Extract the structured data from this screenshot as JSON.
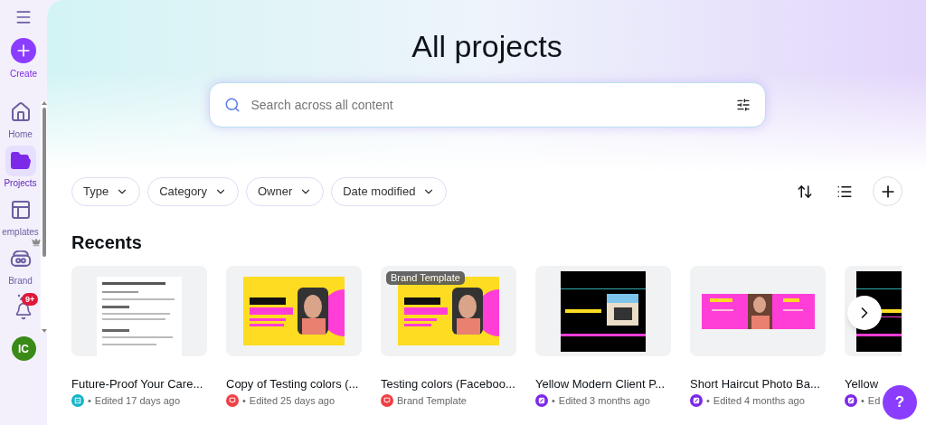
{
  "sidebar": {
    "create": {
      "label": "Create"
    },
    "items": [
      {
        "label": "Home",
        "kind": "home",
        "selected": false,
        "crown": false
      },
      {
        "label": "Projects",
        "kind": "folder",
        "selected": true,
        "crown": false
      },
      {
        "label": "emplates",
        "kind": "templates",
        "selected": false,
        "crown": false
      },
      {
        "label": "Brand",
        "kind": "brand",
        "selected": false,
        "crown": true
      }
    ],
    "notifications": {
      "badge": "9+"
    },
    "avatar": {
      "initials": "IC"
    }
  },
  "header": {
    "title": "All projects",
    "search": {
      "placeholder": "Search across all content"
    }
  },
  "filters": [
    {
      "label": "Type"
    },
    {
      "label": "Category"
    },
    {
      "label": "Owner"
    },
    {
      "label": "Date modified"
    }
  ],
  "recents": {
    "title": "Recents",
    "items": [
      {
        "title": "Future-Proof Your Care...",
        "kind": "doc",
        "dot": "•",
        "meta": "Edited 17 days ago"
      },
      {
        "title": "Copy of Testing colors  (...",
        "kind": "presentation",
        "dot": "•",
        "meta": "Edited 25 days ago"
      },
      {
        "title": "Testing colors  (Faceboo...",
        "kind": "presentation",
        "meta": "Brand Template",
        "badge": "Brand Template"
      },
      {
        "title": "Yellow Modern Client P...",
        "kind": "design",
        "dot": "•",
        "meta": "Edited 3 months ago"
      },
      {
        "title": "Short Haircut Photo Ba...",
        "kind": "design",
        "dot": "•",
        "meta": "Edited 4 months ago"
      },
      {
        "title": "Yellow",
        "kind": "design",
        "dot": "•",
        "meta": "Ed"
      }
    ]
  },
  "help": {
    "label": "?"
  }
}
